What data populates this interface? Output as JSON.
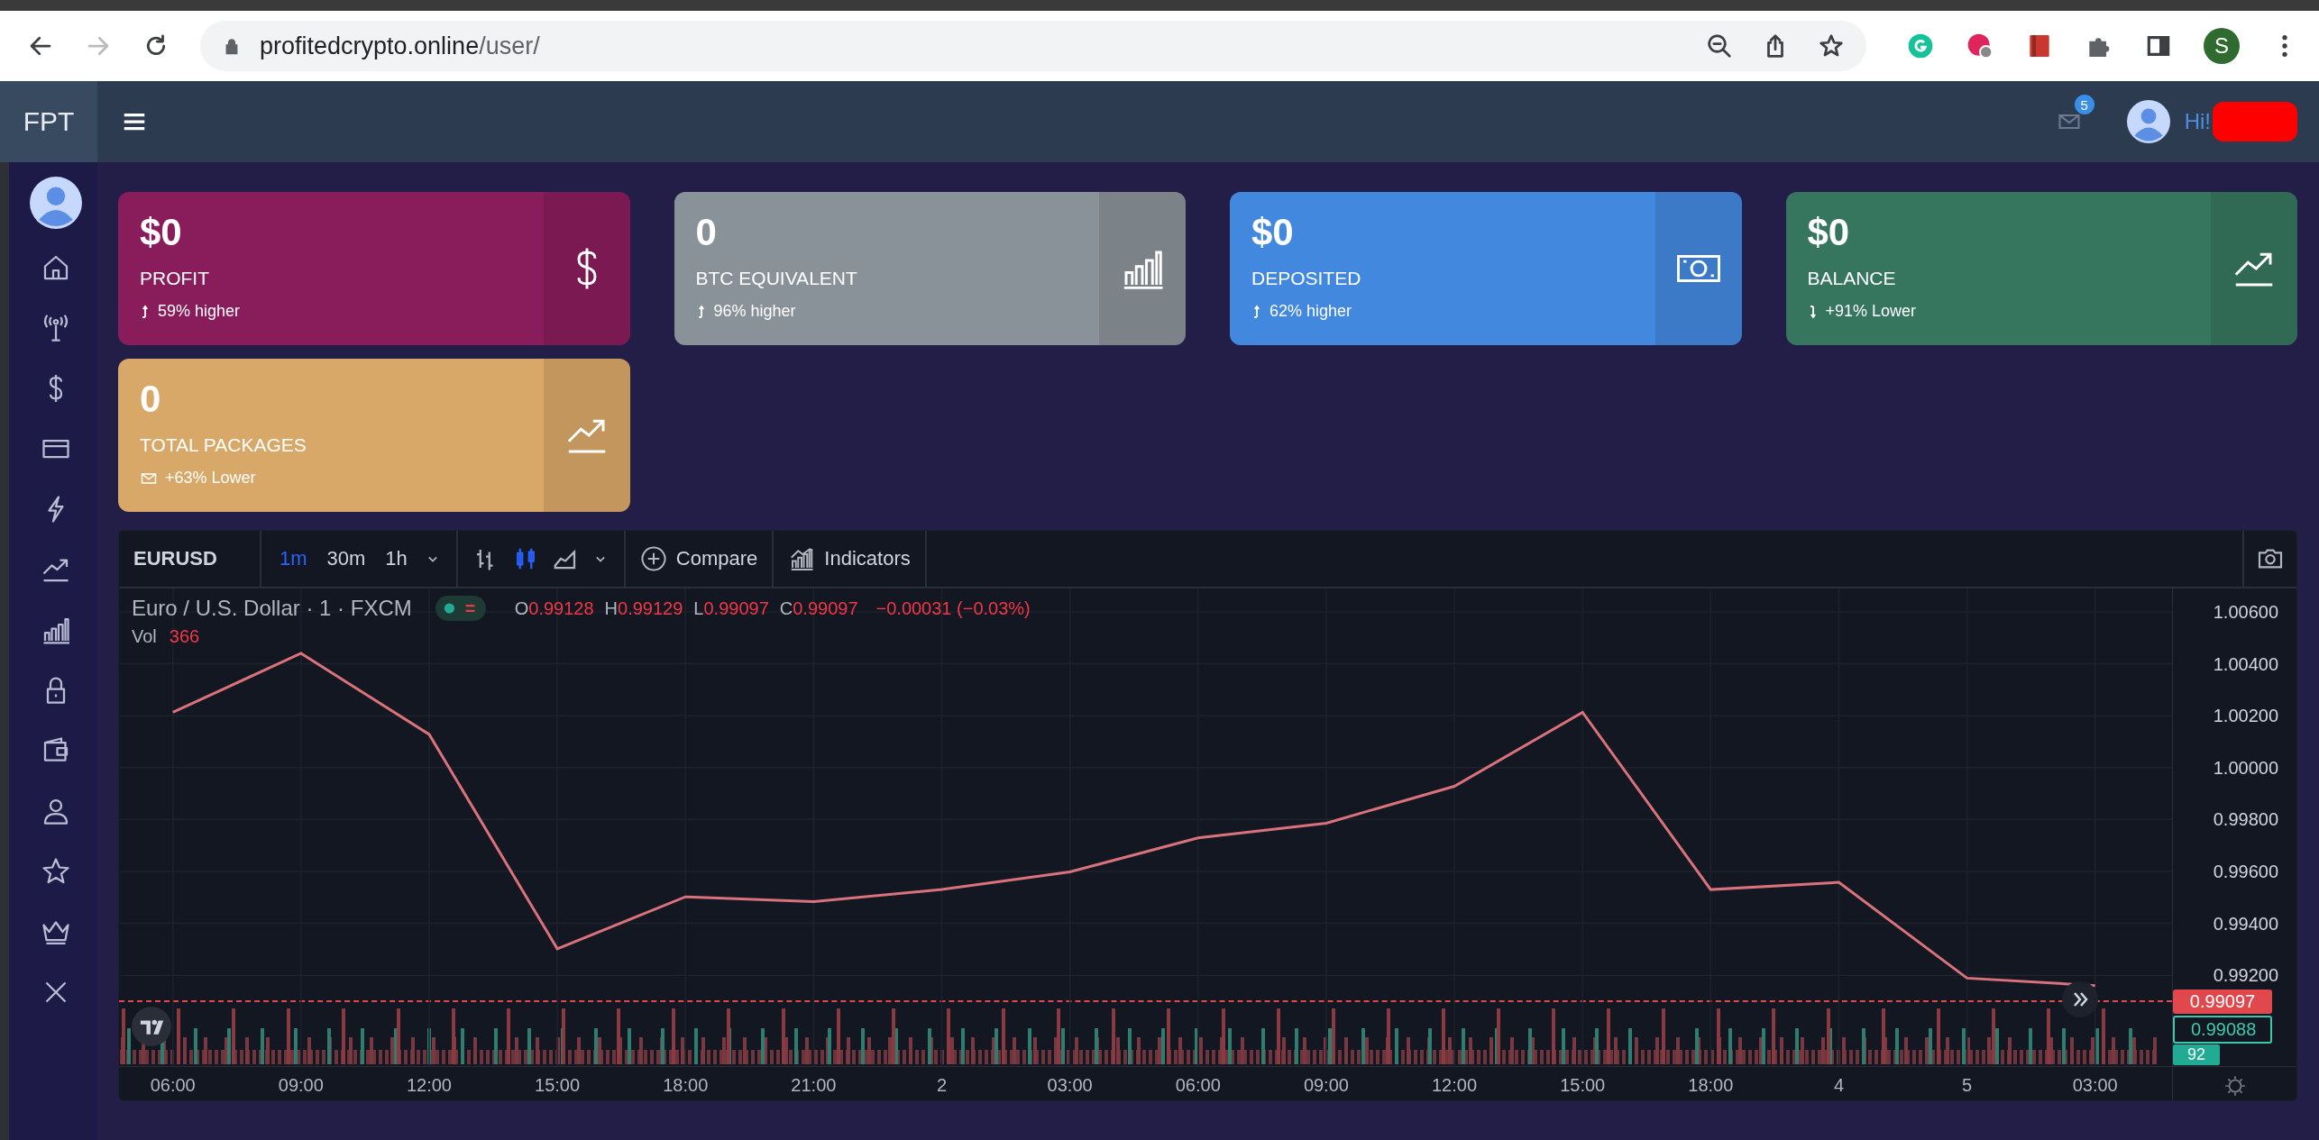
{
  "browser": {
    "url_host": "profitedcrypto.online",
    "url_path": "/user/",
    "forward_disabled": true,
    "profile_initial": "S"
  },
  "header": {
    "logo": "FPT",
    "notification_count": "5",
    "greeting": "Hi!"
  },
  "cards": [
    {
      "value": "$0",
      "label": "PROFIT",
      "trend": {
        "kind": "up",
        "text": "59% higher"
      },
      "color": "#891d5c"
    },
    {
      "value": "0",
      "label": "BTC EQUIVALENT",
      "trend": {
        "kind": "up",
        "text": "96% higher"
      },
      "color": "#8a9299"
    },
    {
      "value": "$0",
      "label": "DEPOSITED",
      "trend": {
        "kind": "up",
        "text": "62% higher"
      },
      "color": "#4388df"
    },
    {
      "value": "$0",
      "label": "BALANCE",
      "trend": {
        "kind": "down",
        "text": "+91% Lower"
      },
      "color": "#36765f"
    },
    {
      "value": "0",
      "label": "TOTAL PACKAGES",
      "trend": {
        "kind": "mail",
        "text": "+63% Lower"
      },
      "color": "#d8a868"
    }
  ],
  "chart": {
    "intervals": [
      {
        "label": "1m",
        "selected": true
      },
      {
        "label": "30m",
        "selected": false
      },
      {
        "label": "1h",
        "selected": false
      }
    ],
    "chart_styles": [
      {
        "kind": "bars",
        "selected": false
      },
      {
        "kind": "candles",
        "selected": true
      },
      {
        "kind": "area",
        "selected": false
      }
    ],
    "compare": "Compare",
    "indicators": "Indicators",
    "legend": {
      "title": "Euro / U.S. Dollar · 1 · FXCM",
      "ohlc": [
        {
          "key": "O",
          "value": "0.99128"
        },
        {
          "key": "H",
          "value": "0.99129"
        },
        {
          "key": "L",
          "value": "0.99097"
        },
        {
          "key": "C",
          "value": "0.99097"
        }
      ],
      "change": "−0.00031 (−0.03%)",
      "volume_label": "Vol",
      "volume": "366"
    },
    "price_tags": [
      {
        "text": "0.99097",
        "kind": "filled",
        "color": "#e0484d"
      },
      {
        "text": "0.99088",
        "kind": "outlined",
        "color": "#3cc8ae"
      }
    ],
    "volume_tag": "92",
    "chart_data": {
      "type": "line",
      "categories": [
        "06:00",
        "09:00",
        "12:00",
        "15:00",
        "18:00",
        "21:00",
        "2",
        "03:00",
        "06:00",
        "09:00",
        "12:00",
        "15:00",
        "18:00",
        "4",
        "5",
        "03:00"
      ],
      "series": [
        {
          "name": "EURUSD",
          "color": "#d9727a",
          "values": [
            1.00213,
            1.0044,
            1.00128,
            0.99302,
            0.99502,
            0.99484,
            0.9953,
            0.99598,
            0.99729,
            0.99786,
            0.99928,
            1.00213,
            0.9953,
            0.99558,
            0.99189,
            0.9916
          ]
        }
      ],
      "ylim": [
        0.9885,
        1.0069
      ],
      "grid": true,
      "yticks": [
        {
          "value": 1.006,
          "label": "1.00600"
        },
        {
          "value": 1.004,
          "label": "1.00400"
        },
        {
          "value": 1.002,
          "label": "1.00200"
        },
        {
          "value": 1.0,
          "label": "1.00000"
        },
        {
          "value": 0.998,
          "label": "0.99800"
        },
        {
          "value": 0.996,
          "label": "0.99600"
        },
        {
          "value": 0.994,
          "label": "0.99400"
        },
        {
          "value": 0.992,
          "label": "0.99200"
        }
      ]
    }
  }
}
